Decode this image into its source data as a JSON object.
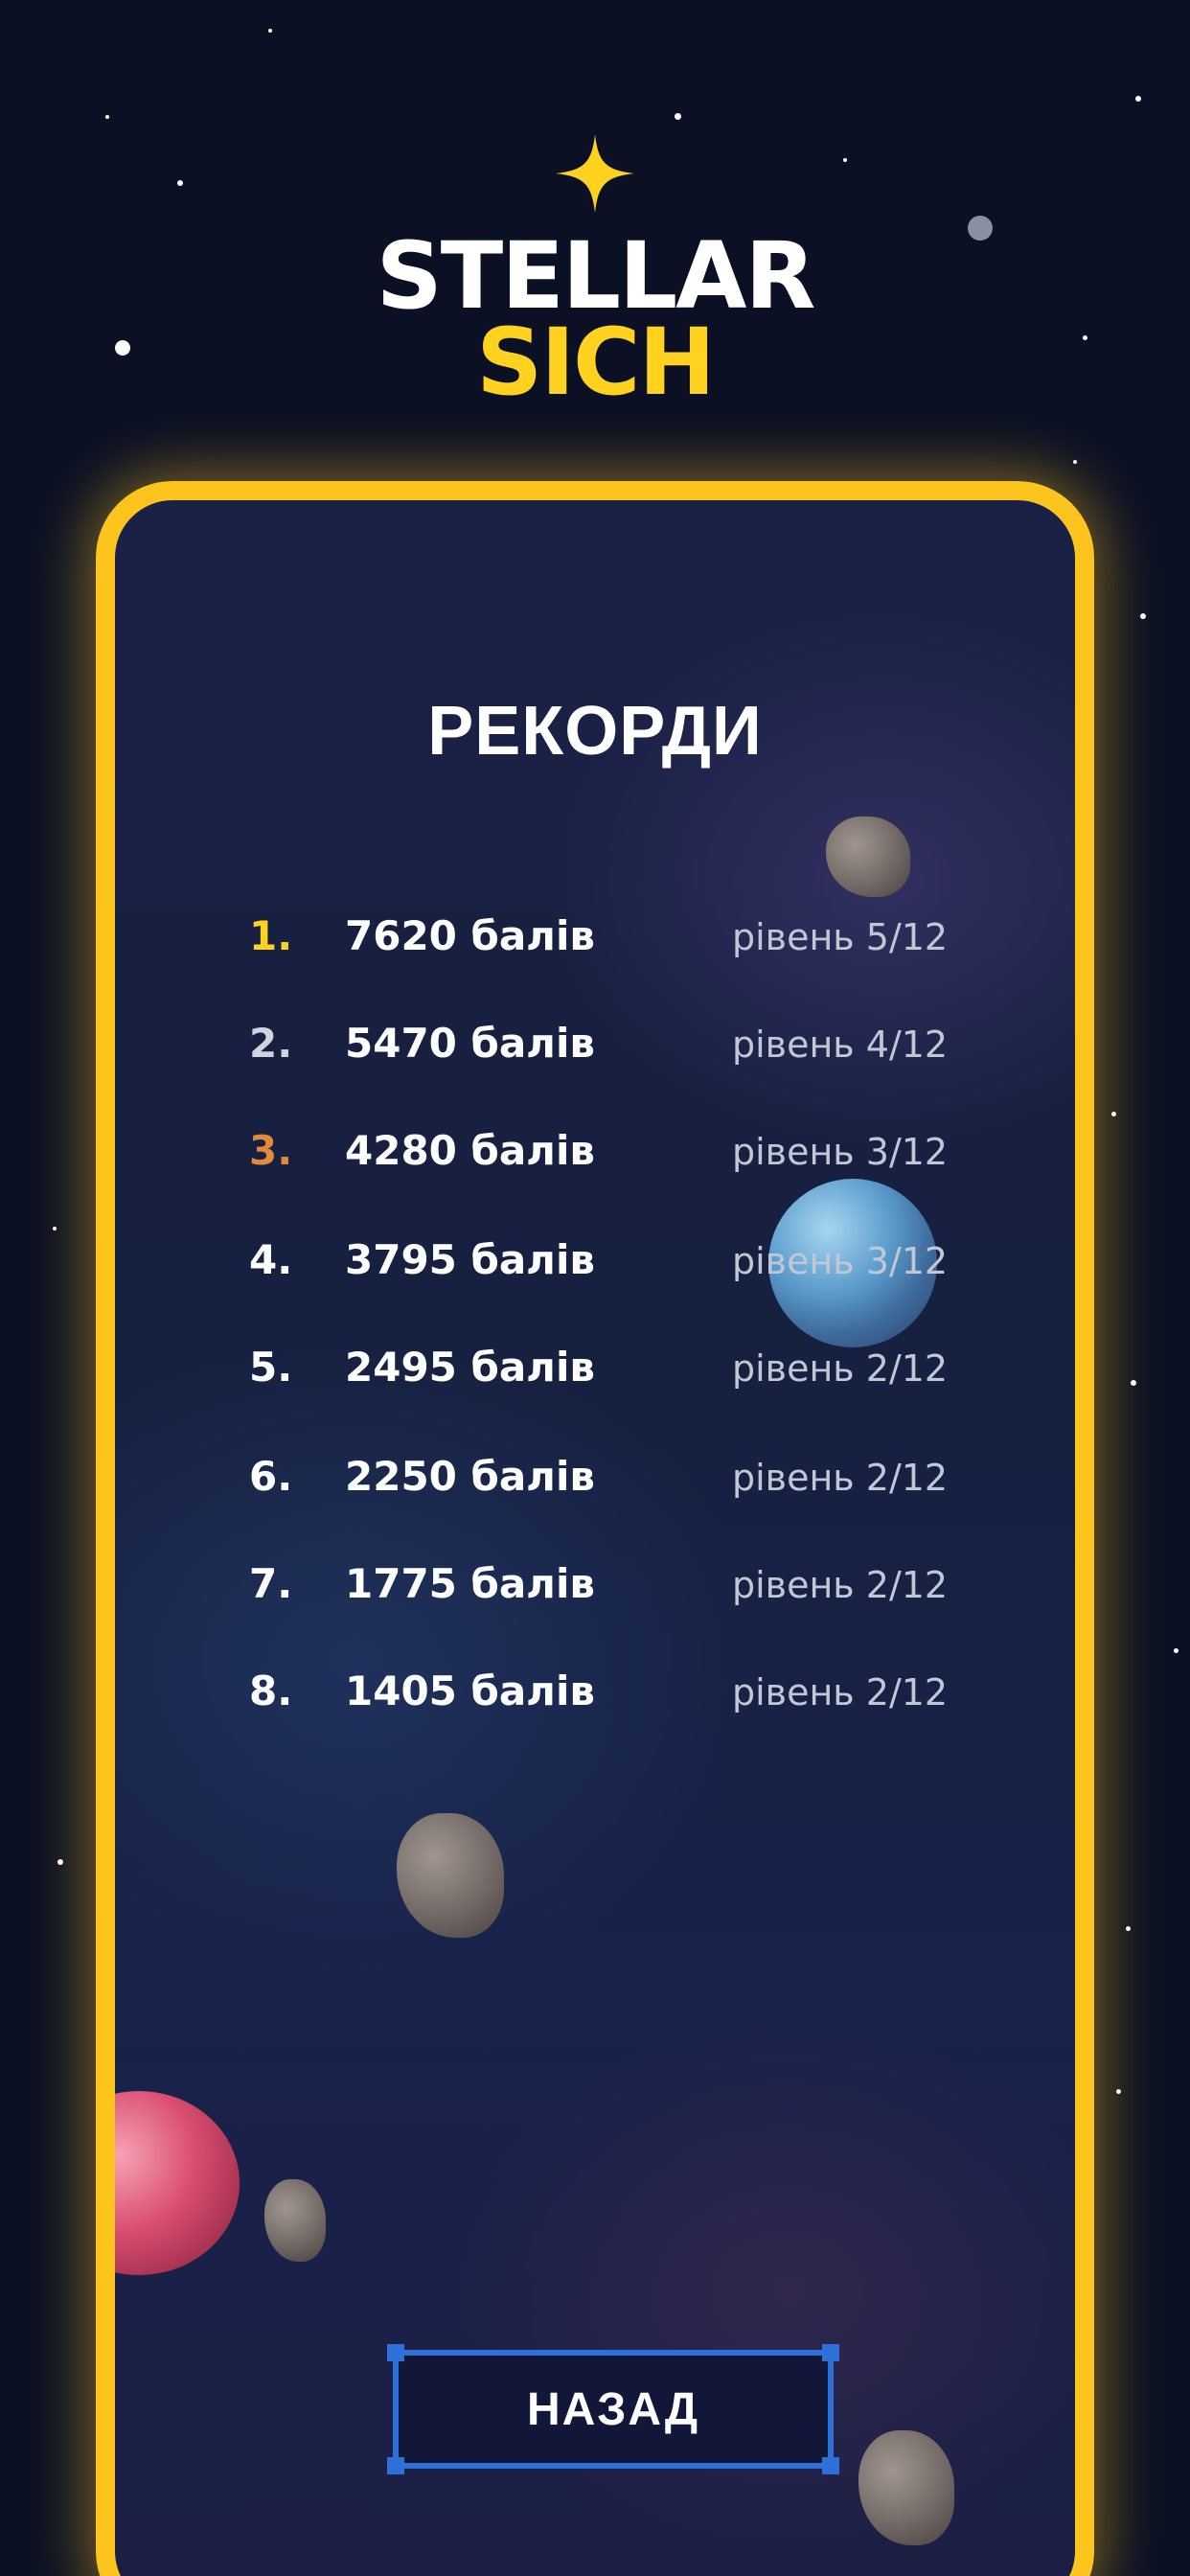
{
  "app": {
    "logo": {
      "line1": "STELLAR",
      "line2": "SICH"
    }
  },
  "screen": {
    "title": "РЕКОРДИ",
    "scores": [
      {
        "rank": "1.",
        "score": "7620 балів",
        "level": "рівень 5/12",
        "rank_color": "#ffd21f"
      },
      {
        "rank": "2.",
        "score": "5470 балів",
        "level": "рівень 4/12",
        "rank_color": "#d0d4de"
      },
      {
        "rank": "3.",
        "score": "4280 балів",
        "level": "рівень 3/12",
        "rank_color": "#e38a3a"
      },
      {
        "rank": "4.",
        "score": "3795 балів",
        "level": "рівень 3/12",
        "rank_color": "#ffffff"
      },
      {
        "rank": "5.",
        "score": "2495 балів",
        "level": "рівень 2/12",
        "rank_color": "#ffffff"
      },
      {
        "rank": "6.",
        "score": "2250 балів",
        "level": "рівень 2/12",
        "rank_color": "#ffffff"
      },
      {
        "rank": "7.",
        "score": "1775 балів",
        "level": "рівень 2/12",
        "rank_color": "#ffffff"
      },
      {
        "rank": "8.",
        "score": "1405 балів",
        "level": "рівень 2/12",
        "rank_color": "#ffffff"
      }
    ],
    "back_label": "НАЗАД"
  },
  "colors": {
    "background": "#0b1024",
    "frame": "#fcc41d",
    "accent": "#ffd21f",
    "button_border": "#2e6fd8"
  },
  "icons": {
    "logo_star": "sparkle-star-icon",
    "decor": [
      "asteroid",
      "planet-blue",
      "planet-pink"
    ]
  }
}
